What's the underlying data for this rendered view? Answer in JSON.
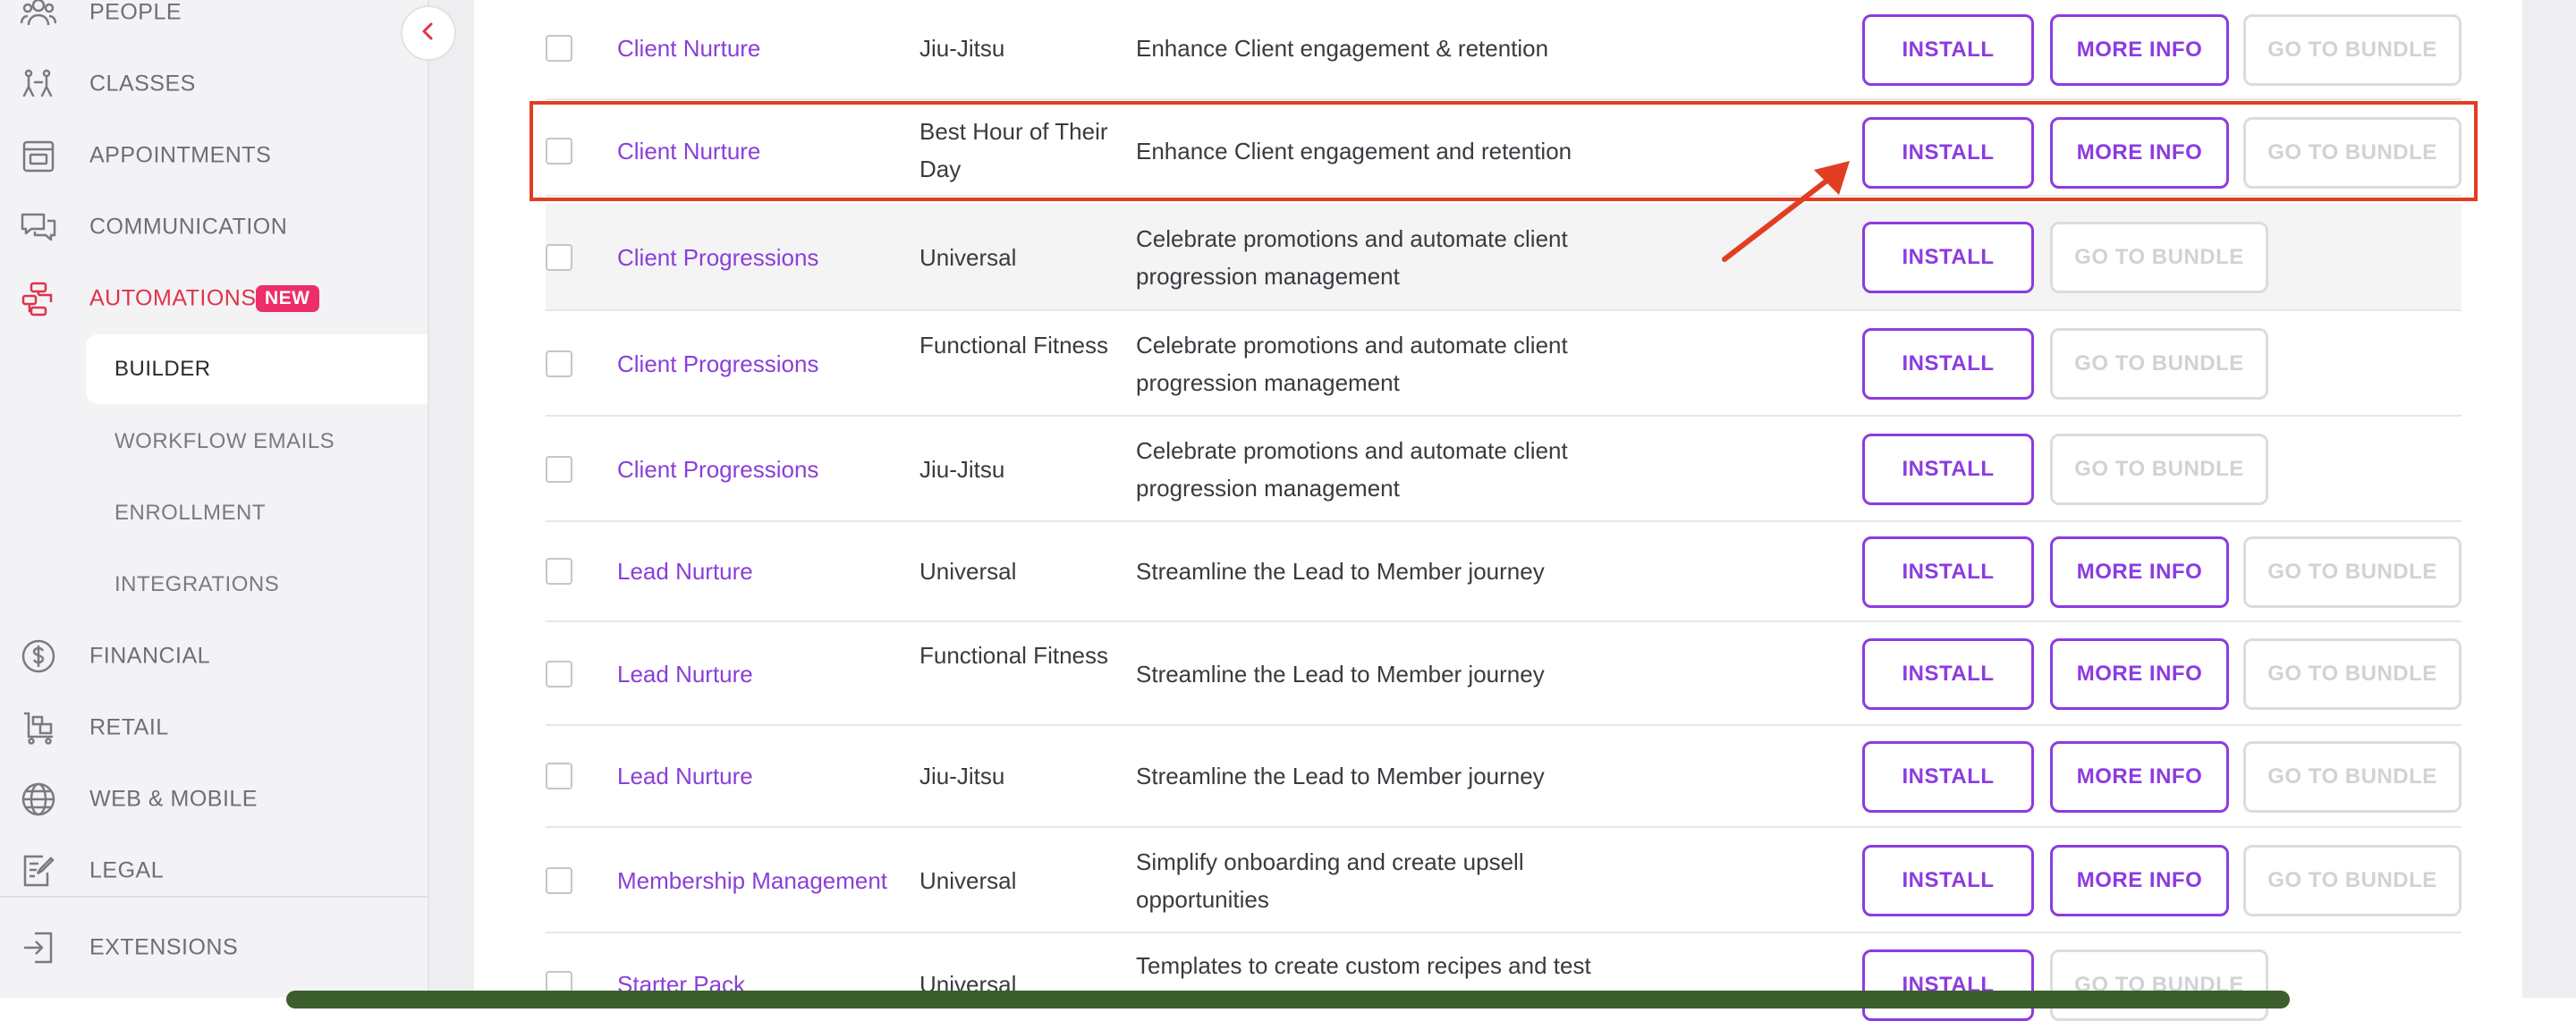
{
  "sidebar": {
    "nav": [
      {
        "label": "PEOPLE",
        "icon": "people-icon"
      },
      {
        "label": "CLASSES",
        "icon": "classes-icon"
      },
      {
        "label": "APPOINTMENTS",
        "icon": "calendar-icon"
      },
      {
        "label": "COMMUNICATION",
        "icon": "chat-icon"
      },
      {
        "label": "AUTOMATIONS",
        "icon": "automations-icon",
        "badge": "NEW",
        "active": true
      }
    ],
    "sub_items": [
      {
        "label": "BUILDER",
        "active": true
      },
      {
        "label": "WORKFLOW EMAILS"
      },
      {
        "label": "ENROLLMENT"
      },
      {
        "label": "INTEGRATIONS"
      }
    ],
    "nav_bottom": [
      {
        "label": "FINANCIAL",
        "icon": "dollar-icon"
      },
      {
        "label": "RETAIL",
        "icon": "cart-icon"
      },
      {
        "label": "WEB & MOBILE",
        "icon": "globe-icon"
      },
      {
        "label": "LEGAL",
        "icon": "document-edit-icon"
      }
    ],
    "footer_item": {
      "label": "EXTENSIONS",
      "icon": "extensions-icon"
    }
  },
  "buttons": {
    "install": "INSTALL",
    "more_info": "MORE INFO",
    "go_to_bundle": "GO TO BUNDLE"
  },
  "rows": [
    {
      "name": "Client Nurture",
      "type": "Jiu-Jitsu",
      "description": "Enhance Client engagement & retention",
      "has_more_info": true
    },
    {
      "name": "Client Nurture",
      "type": "Best Hour of Their Day",
      "description": "Enhance Client engagement and retention",
      "has_more_info": true,
      "highlighted": true
    },
    {
      "name": "Client Progressions",
      "type": "Universal",
      "description": "Celebrate promotions and automate client progression management",
      "has_more_info": false
    },
    {
      "name": "Client Progressions",
      "type": "Functional Fitness",
      "description": "Celebrate promotions and automate client progression management",
      "has_more_info": false
    },
    {
      "name": "Client Progressions",
      "type": "Jiu-Jitsu",
      "description": "Celebrate promotions and automate client progression management",
      "has_more_info": false
    },
    {
      "name": "Lead Nurture",
      "type": "Universal",
      "description": "Streamline the Lead to Member journey",
      "has_more_info": true
    },
    {
      "name": "Lead Nurture",
      "type": "Functional Fitness",
      "description": "Streamline the Lead to Member journey",
      "has_more_info": true
    },
    {
      "name": "Lead Nurture",
      "type": "Jiu-Jitsu",
      "description": "Streamline the Lead to Member journey",
      "has_more_info": true
    },
    {
      "name": "Membership Management",
      "type": "Universal",
      "description": "Simplify onboarding and create upsell opportunities",
      "has_more_info": true
    },
    {
      "name": "Starter Pack",
      "type": "Universal",
      "description": "Templates to create custom recipes and test",
      "has_more_info": false
    }
  ],
  "colors": {
    "accent": "#8c3be0",
    "active_nav": "#e0334a",
    "badge": "#ec2e6a",
    "highlight": "#e23d22"
  }
}
